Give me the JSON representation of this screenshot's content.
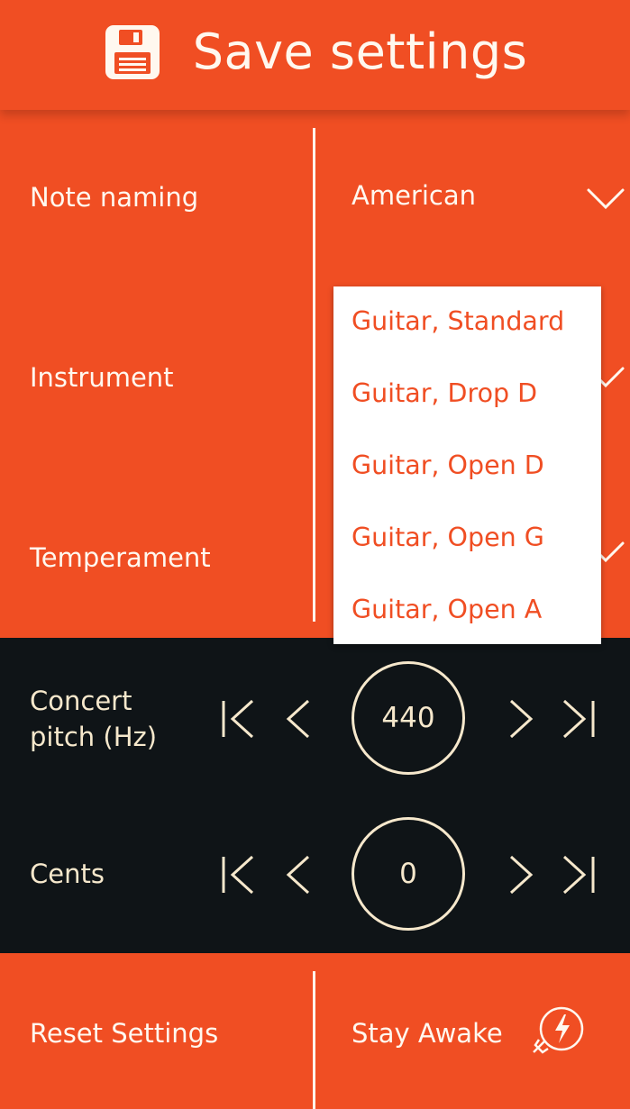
{
  "header": {
    "title": "Save settings",
    "icon": "floppy-disk-icon"
  },
  "settings": {
    "note_naming": {
      "label": "Note naming",
      "value": "American"
    },
    "instrument": {
      "label": "Instrument"
    },
    "temperament": {
      "label": "Temperament"
    }
  },
  "dropdown": {
    "options": [
      "Guitar, Standard",
      "Guitar, Drop D",
      "Guitar, Open D",
      "Guitar, Open G",
      "Guitar, Open A"
    ]
  },
  "concert_pitch": {
    "label_line1": "Concert",
    "label_line2": "pitch (Hz)",
    "value": "440"
  },
  "cents": {
    "label": "Cents",
    "value": "0"
  },
  "footer": {
    "reset_label": "Reset Settings",
    "stay_awake_label": "Stay Awake",
    "stay_awake_icon": "lightbulb-bolt-icon"
  },
  "colors": {
    "accent": "#f04e23",
    "dark": "#0f1417",
    "cream": "#f6e8cc"
  }
}
